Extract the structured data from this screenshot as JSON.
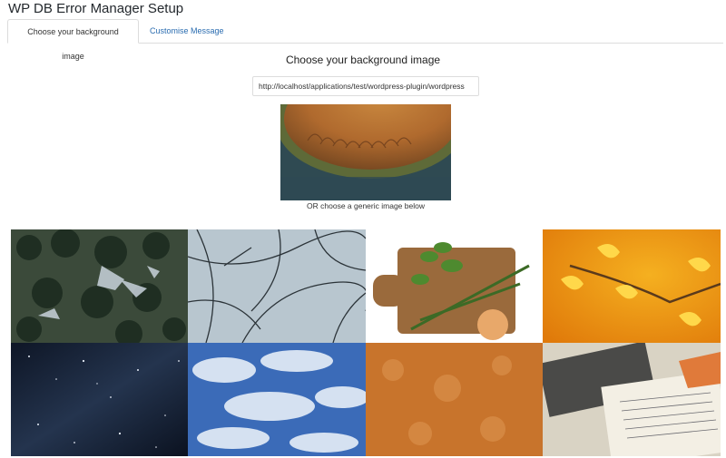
{
  "page": {
    "title": "WP DB Error Manager Setup"
  },
  "tabs": [
    {
      "label": "Choose your background image",
      "active": true
    },
    {
      "label": "Customise Message",
      "active": false
    }
  ],
  "background": {
    "heading": "Choose your background image",
    "image_url": "http://localhost/applications/test/wordpress-plugin/wordpress",
    "or_caption": "OR choose a generic image below"
  },
  "generic_images": [
    {
      "name": "snowy-forest-aerial"
    },
    {
      "name": "frosted-branches"
    },
    {
      "name": "herbs-on-cutting-board"
    },
    {
      "name": "yellow-ginkgo-leaves"
    },
    {
      "name": "starry-night-sky"
    },
    {
      "name": "blue-sky-clouds"
    },
    {
      "name": "orange-texture"
    },
    {
      "name": "old-letters-photos"
    }
  ],
  "colors": {
    "link": "#2a6cb0",
    "tab_border": "#dcdcdc"
  }
}
